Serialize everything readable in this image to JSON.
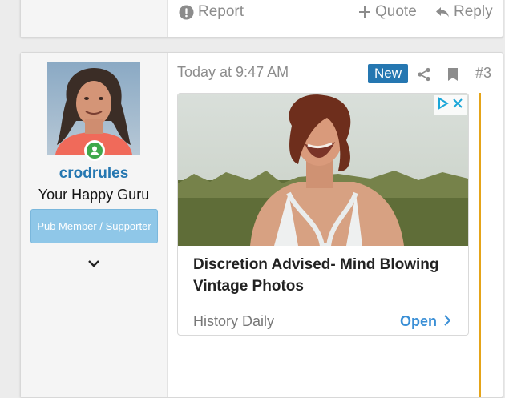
{
  "previous_post": {
    "actions": {
      "report": "Report",
      "quote": "Quote",
      "reply": "Reply"
    }
  },
  "post": {
    "user": {
      "username": "crodrules",
      "title": "Your Happy Guru",
      "banner": "Pub Member / Supporter",
      "status": "online"
    },
    "timestamp": "Today at 9:47 AM",
    "new_badge": "New",
    "post_number": "#3",
    "ad": {
      "title": "Discretion Advised- Mind Blowing Vintage Photos",
      "source": "History Daily",
      "cta": "Open"
    }
  },
  "colors": {
    "accent": "#2577b1",
    "ad_cta": "#3a8fd6",
    "banner": "#8fc7e8",
    "online": "#3ea84b",
    "gold": "#e5a419"
  },
  "icons": [
    "exclamation-circle-icon",
    "plus-icon",
    "reply-arrow-icon",
    "user-online-icon",
    "chevron-down-icon",
    "share-icon",
    "bookmark-icon",
    "adchoices-icon",
    "close-icon",
    "chevron-right-icon"
  ]
}
